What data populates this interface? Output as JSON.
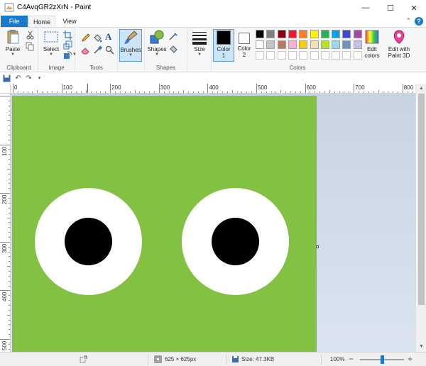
{
  "window": {
    "title": "C4AvqGR2zXrN - Paint",
    "minimize_label": "—",
    "maximize_label": "☐",
    "close_label": "✕"
  },
  "tabs": [
    {
      "label": "File"
    },
    {
      "label": "Home"
    },
    {
      "label": "View"
    }
  ],
  "help_label": "?",
  "collapse_label": "⌃",
  "ribbon": {
    "clipboard": {
      "group_label": "Clipboard",
      "paste_label": "Paste"
    },
    "image": {
      "group_label": "Image",
      "select_label": "Select"
    },
    "tools": {
      "group_label": "Tools",
      "text_tool_label": "A"
    },
    "brushes": {
      "label": "Brushes"
    },
    "shapes": {
      "group_label": "Shapes",
      "label": "Shapes"
    },
    "size": {
      "label": "Size"
    },
    "colors": {
      "group_label": "Colors",
      "color1_label": "Color 1",
      "color2_label": "Color 2",
      "color1_value": "#000000",
      "color2_value": "#ffffff",
      "edit_colors_label": "Edit colors",
      "edit_paint3d_label": "Edit with Paint 3D",
      "palette_row1": [
        "#000000",
        "#7f7f7f",
        "#880015",
        "#ed1c24",
        "#ff7f27",
        "#fff200",
        "#22b14c",
        "#00a2e8",
        "#3f48cc",
        "#a349a4"
      ],
      "palette_row2": [
        "#ffffff",
        "#c3c3c3",
        "#b97a57",
        "#ffaec9",
        "#ffc90e",
        "#efe4b0",
        "#b5e61d",
        "#99d9ea",
        "#7092be",
        "#c8bfe7"
      ]
    }
  },
  "ruler": {
    "h_labels": [
      "0",
      "100",
      "200",
      "300",
      "400",
      "500",
      "600",
      "700",
      "800"
    ],
    "v_labels": [
      "100",
      "200",
      "300",
      "400",
      "500"
    ]
  },
  "canvas": {
    "background_color": "#83c143",
    "eye_color": "#ffffff",
    "pupil_color": "#000000"
  },
  "status": {
    "dimensions": "625 × 625px",
    "size": "Size: 47.3KB",
    "zoom": "100%",
    "zoom_minus": "−",
    "zoom_plus": "+",
    "zoom_fraction": 0.5
  }
}
